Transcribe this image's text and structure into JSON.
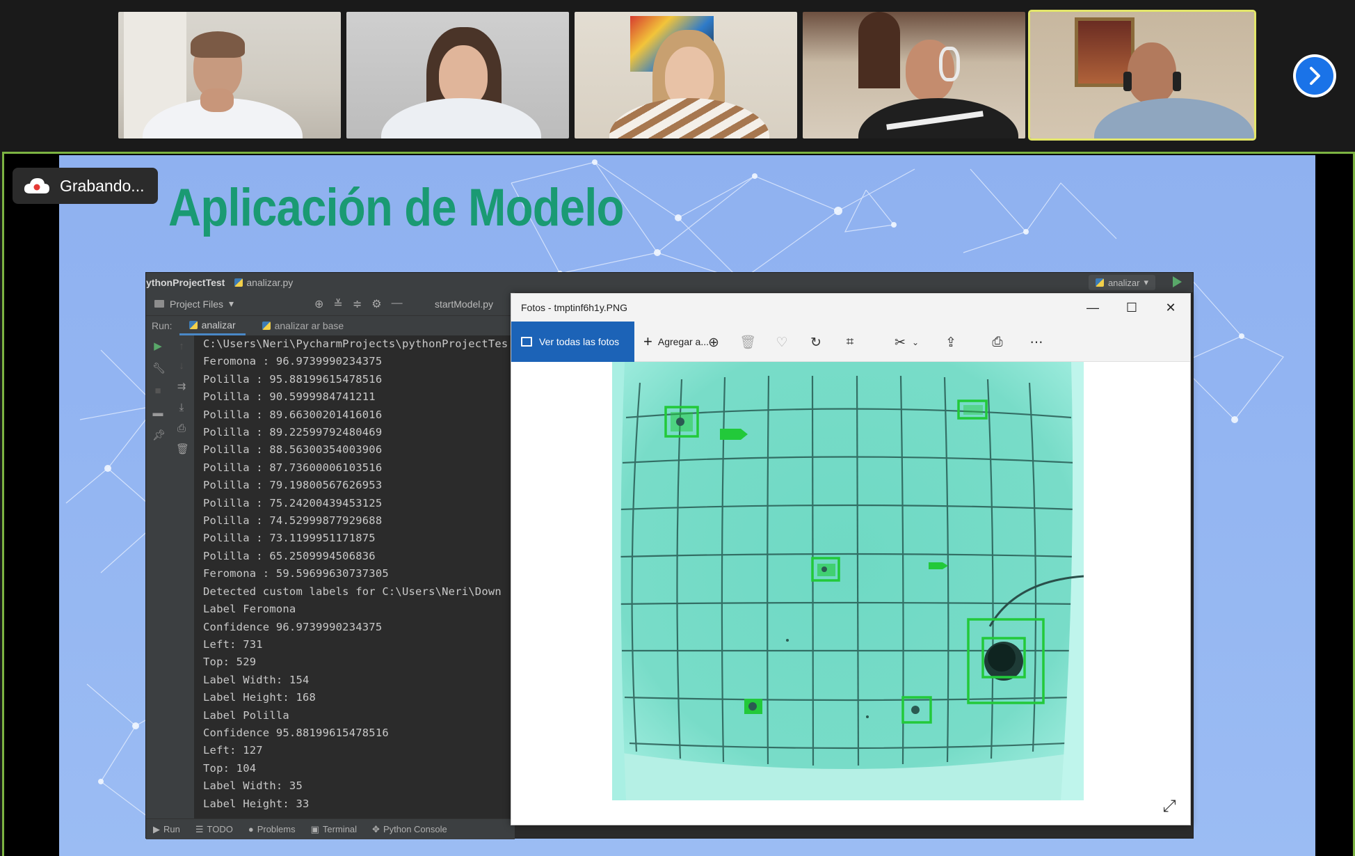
{
  "meeting": {
    "recording_label": "Grabando...",
    "participants": [
      {
        "id": "p1",
        "active": false
      },
      {
        "id": "p2",
        "active": false
      },
      {
        "id": "p3",
        "active": false
      },
      {
        "id": "p4",
        "active": false
      },
      {
        "id": "p5",
        "active": true
      }
    ],
    "next_icon": "chevron-right-icon"
  },
  "slide": {
    "title": "Aplicación de Modelo",
    "title_color": "#1a9a73",
    "background_color": "#93b5f2"
  },
  "ide": {
    "project": "ythonProjectTest",
    "file_tab": "analizar.py",
    "run_config": "analizar",
    "project_files_label": "Project Files",
    "start_model_tab": "startModel.py",
    "run_label": "Run:",
    "run_tabs": [
      "analizar",
      "analizar ar base"
    ],
    "console_lines": [
      "C:\\Users\\Neri\\PycharmProjects\\pythonProjectTes",
      "Feromona : 96.9739990234375",
      "Polilla : 95.88199615478516",
      "Polilla : 90.5999984741211",
      "Polilla : 89.66300201416016",
      "Polilla : 89.22599792480469",
      "Polilla : 88.56300354003906",
      "Polilla : 87.73600006103516",
      "Polilla : 79.19800567626953",
      "Polilla : 75.24200439453125",
      "Polilla : 74.52999877929688",
      "Polilla : 73.1199951171875",
      "Polilla : 65.2509994506836",
      "Feromona : 59.59699630737305",
      "Detected custom labels for C:\\Users\\Neri\\Down",
      "Label Feromona",
      "Confidence 96.9739990234375",
      "Left: 731",
      "Top: 529",
      "Label Width: 154",
      "Label Height: 168",
      "Label Polilla",
      "Confidence 95.88199615478516",
      "Left: 127",
      "Top: 104",
      "Label Width: 35",
      "Label Height: 33"
    ],
    "status_tabs": [
      "Run",
      "TODO",
      "Problems",
      "Terminal",
      "Python Console"
    ]
  },
  "photos": {
    "window_title": "Fotos - tmptinf6h1y.PNG",
    "view_all_label": "Ver todas las fotos",
    "add_label": "Agregar a...",
    "toolbar_icons": [
      "zoom-in-icon",
      "delete-icon",
      "heart-icon",
      "rotate-icon",
      "crop-icon",
      "edit-icon",
      "share-icon",
      "print-icon",
      "more-icon"
    ],
    "detection_color": "#22c93a"
  }
}
